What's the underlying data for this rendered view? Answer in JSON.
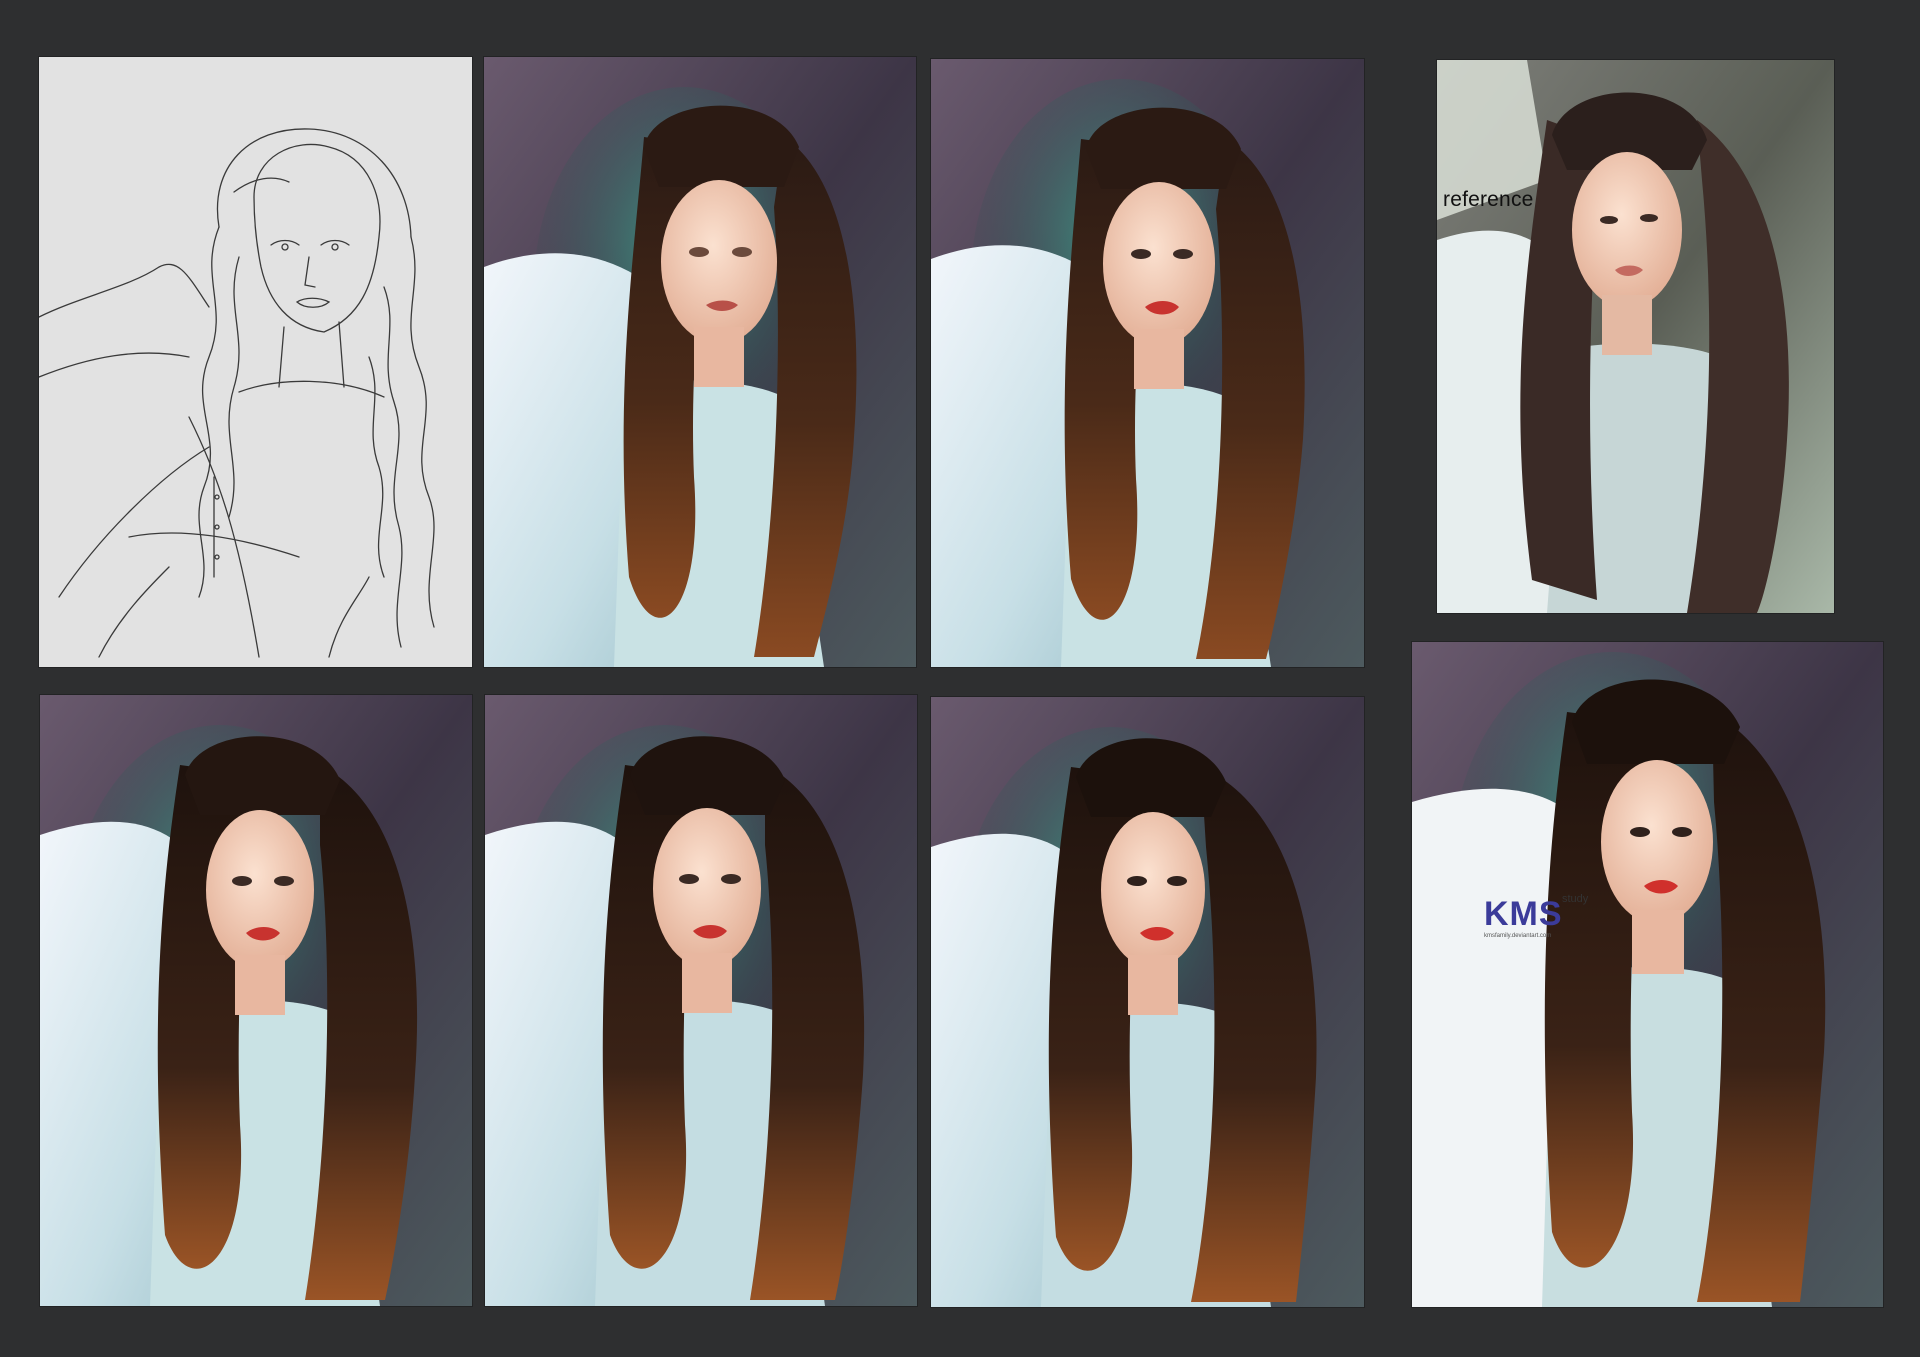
{
  "panels": [
    {
      "id": "sketch",
      "stage": "line-sketch"
    },
    {
      "id": "stage-2",
      "stage": "base-colors"
    },
    {
      "id": "stage-3",
      "stage": "face-refine"
    },
    {
      "id": "reference",
      "stage": "reference-photo",
      "label": "reference"
    },
    {
      "id": "stage-5",
      "stage": "hair-blocking"
    },
    {
      "id": "stage-6",
      "stage": "hair-detail"
    },
    {
      "id": "stage-7",
      "stage": "curl-refine"
    },
    {
      "id": "final",
      "stage": "final-render"
    }
  ],
  "watermark": {
    "logo": "KMS",
    "suffix": "study",
    "url": "kmsfamily.deviantart.com"
  },
  "colors": {
    "background": "#2e2f30",
    "sketch_paper": "#e2e2e2",
    "hair_dark": "#2a1a12",
    "hair_warm": "#7a4320",
    "dress": "#cfe6ec",
    "backdrop": "#5a4b60",
    "skin": "#f2cdb8",
    "lips": "#c8332f"
  }
}
